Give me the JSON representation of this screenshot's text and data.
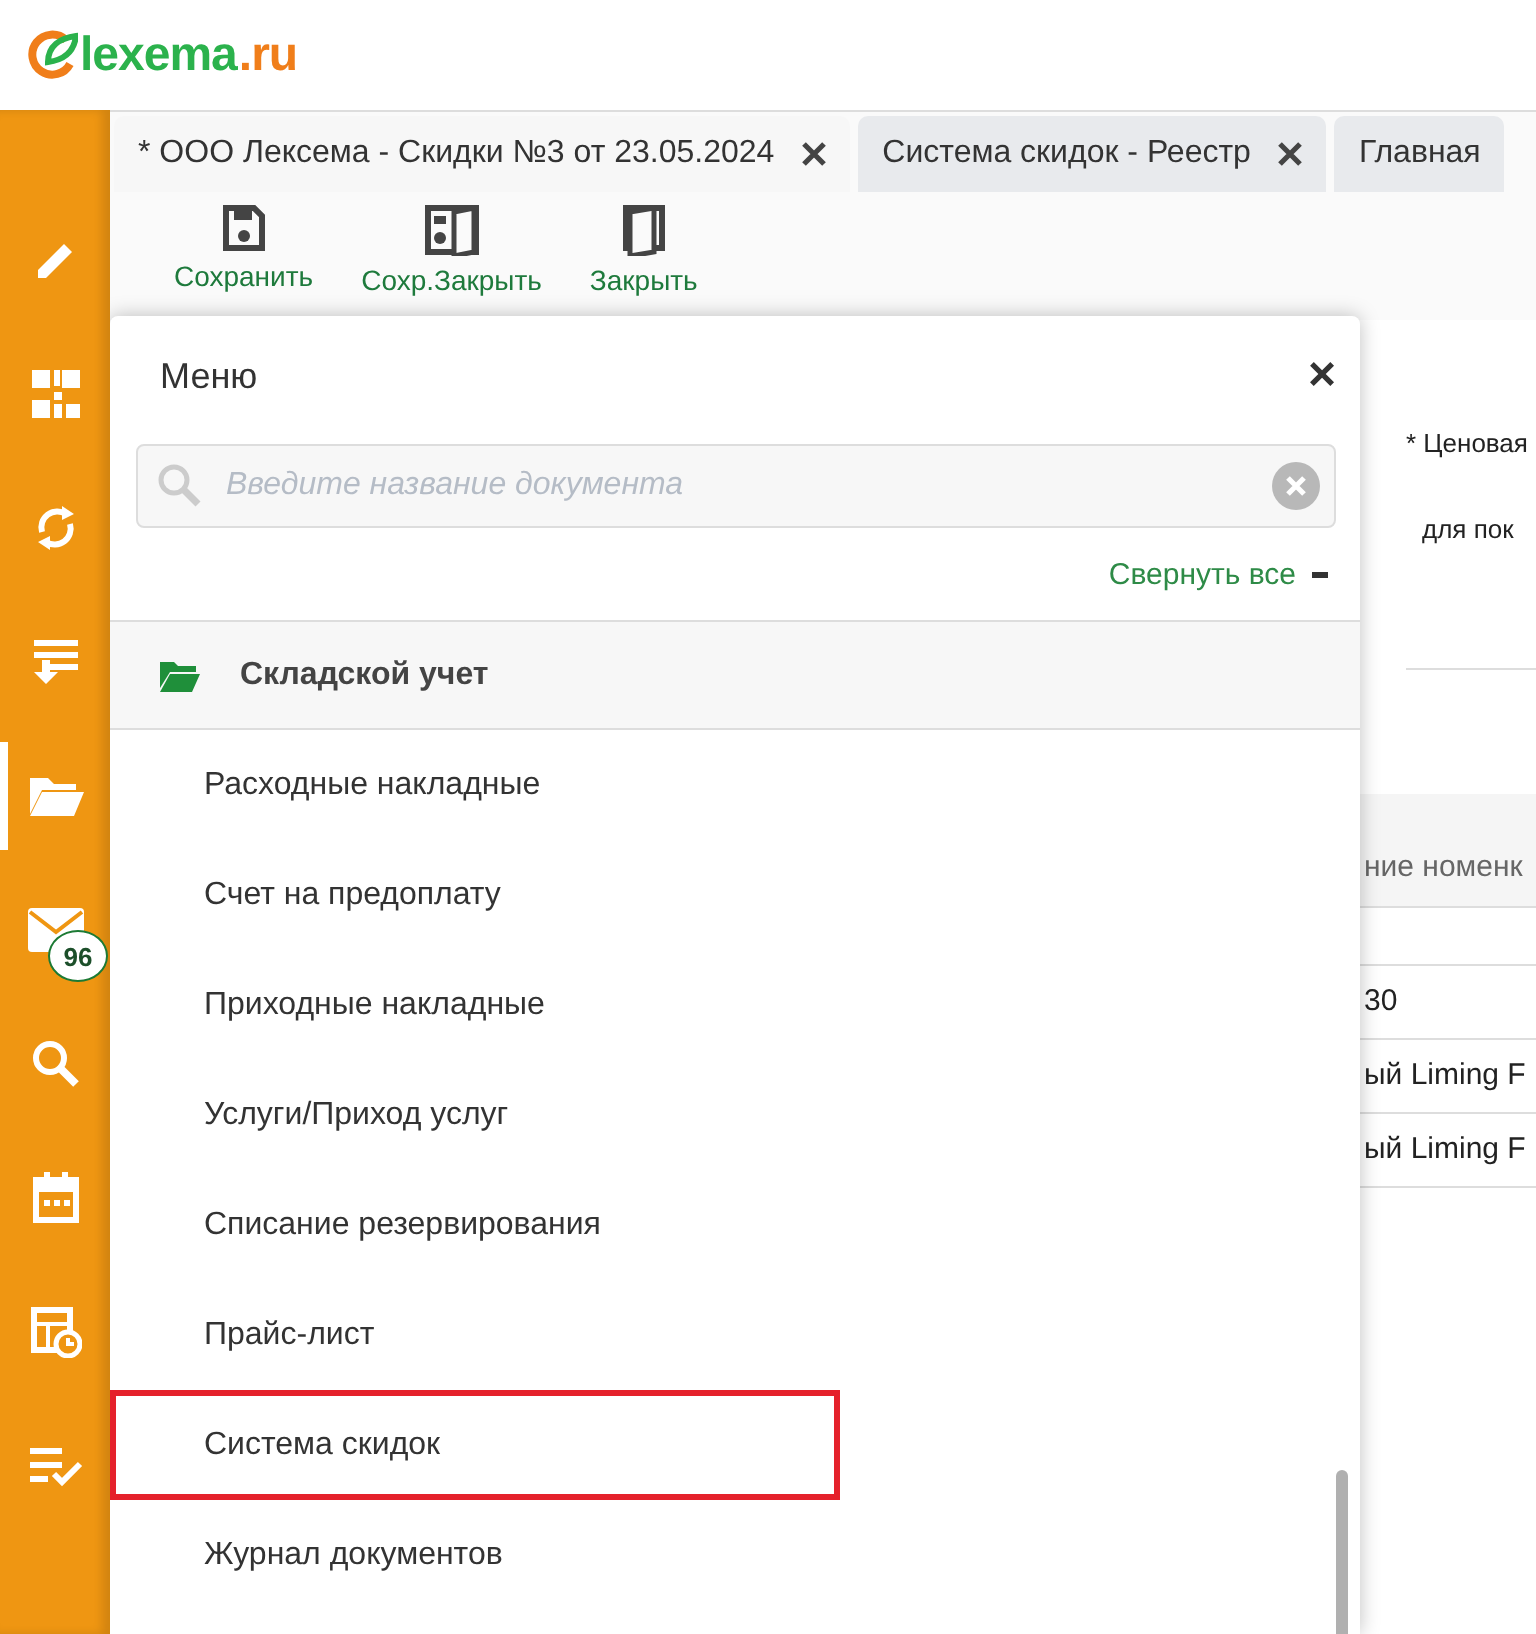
{
  "logo": {
    "text": "lexema",
    "suffix": ".ru"
  },
  "sidebar": {
    "items": [
      {
        "kind": "pencil",
        "selected": false
      },
      {
        "kind": "qr",
        "selected": false
      },
      {
        "kind": "sync",
        "selected": false
      },
      {
        "kind": "download",
        "selected": false
      },
      {
        "kind": "folder",
        "selected": true
      },
      {
        "kind": "mail",
        "selected": false,
        "badge": "96"
      },
      {
        "kind": "search",
        "selected": false
      },
      {
        "kind": "calendar",
        "selected": false
      },
      {
        "kind": "schedule",
        "selected": false
      },
      {
        "kind": "checklist",
        "selected": false
      }
    ]
  },
  "tabs": [
    {
      "label": "* ООО Лексема - Скидки №3 от 23.05.2024",
      "selected": true,
      "closable": true
    },
    {
      "label": "Система скидок - Реестр",
      "selected": false,
      "closable": true
    },
    {
      "label": "Главная",
      "selected": false,
      "closable": false
    }
  ],
  "toolbar": [
    {
      "kind": "save",
      "label": "Сохранить"
    },
    {
      "kind": "save-close",
      "label": "Сохр.Закрыть"
    },
    {
      "kind": "close",
      "label": "Закрыть"
    }
  ],
  "form": {
    "fields": [
      "* Ценовая",
      "для пок"
    ],
    "table": {
      "header": "ние номенк",
      "rows": [
        "30",
        "ый Liming F",
        "ый Liming F"
      ]
    }
  },
  "menu": {
    "title": "Меню",
    "close": "×",
    "search": {
      "placeholder": "Введите название документа"
    },
    "collapse_all": "Свернуть все",
    "group": {
      "label": "Складской учет",
      "expanded": true,
      "children": [
        {
          "label": "Расходные накладные",
          "highlighted": false
        },
        {
          "label": "Счет на предоплату",
          "highlighted": false
        },
        {
          "label": "Приходные накладные",
          "highlighted": false
        },
        {
          "label": "Услуги/Приход услуг",
          "highlighted": false
        },
        {
          "label": "Списание резервирования",
          "highlighted": false
        },
        {
          "label": "Прайс-лист",
          "highlighted": false
        },
        {
          "label": "Система скидок",
          "highlighted": true
        },
        {
          "label": "Журнал документов",
          "highlighted": false
        }
      ]
    }
  }
}
